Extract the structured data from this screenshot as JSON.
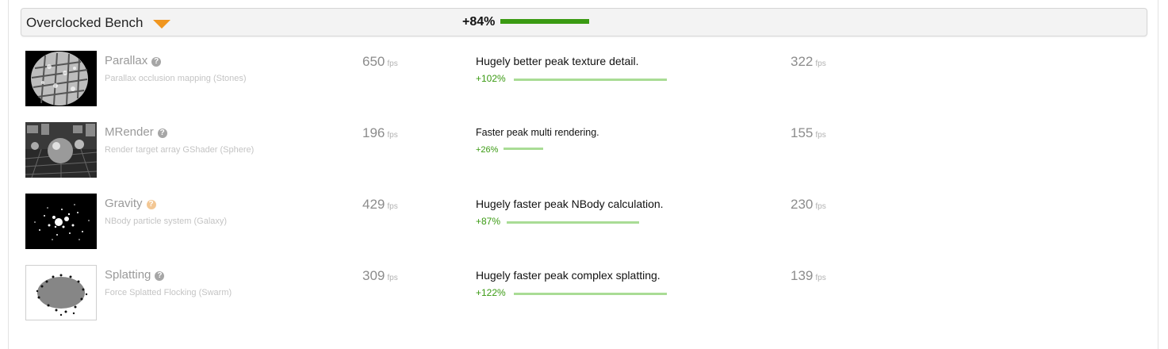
{
  "header": {
    "title": "Overclocked Bench",
    "percent": "+84%",
    "percent_value": 84,
    "bar_color": "#3a9a12",
    "accent_color": "#f0961f"
  },
  "rows": [
    {
      "name": "Parallax",
      "description": "Parallax occlusion mapping (Stones)",
      "score": "650",
      "score_unit": "fps",
      "verdict": "Hugely better peak texture detail.",
      "delta": "+102%",
      "delta_value": 102,
      "other_score": "322",
      "other_unit": "fps",
      "help_icon": "question-circle-icon"
    },
    {
      "name": "MRender",
      "description": "Render target array GShader (Sphere)",
      "score": "196",
      "score_unit": "fps",
      "verdict": "Faster peak multi rendering.",
      "delta": "+26%",
      "delta_value": 26,
      "other_score": "155",
      "other_unit": "fps",
      "help_icon": "question-circle-icon"
    },
    {
      "name": "Gravity",
      "description": "NBody particle system (Galaxy)",
      "score": "429",
      "score_unit": "fps",
      "verdict": "Hugely faster peak NBody calculation.",
      "delta": "+87%",
      "delta_value": 87,
      "other_score": "230",
      "other_unit": "fps",
      "help_icon": "question-circle-icon"
    },
    {
      "name": "Splatting",
      "description": "Force Splatted Flocking (Swarm)",
      "score": "309",
      "score_unit": "fps",
      "verdict": "Hugely faster peak complex splatting.",
      "delta": "+122%",
      "delta_value": 122,
      "other_score": "139",
      "other_unit": "fps",
      "help_icon": "question-circle-icon"
    }
  ]
}
